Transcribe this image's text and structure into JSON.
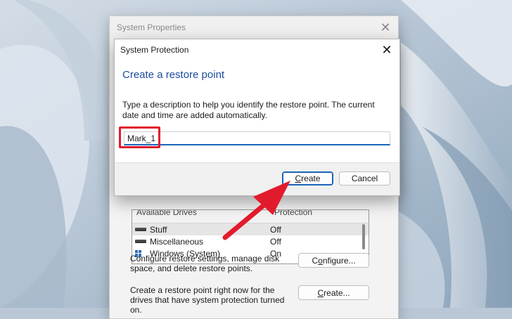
{
  "system_properties": {
    "title": "System Properties",
    "close_glyph": "✕",
    "drives": {
      "header_name": "Available Drives",
      "header_status": "Protection",
      "items": [
        {
          "name": "Stuff",
          "status": "Off",
          "icon": "drive-icon"
        },
        {
          "name": "Miscellaneous",
          "status": "Off",
          "icon": "drive-icon"
        },
        {
          "name": "Windows (System)",
          "status": "On",
          "icon": "windows-drive-icon"
        }
      ]
    },
    "configure_text": "Configure restore settings, manage disk space, and delete restore points.",
    "configure_button": {
      "pre": "C",
      "ul": "o",
      "post": "nfigure..."
    },
    "create_text": "Create a restore point right now for the drives that have system protection turned on.",
    "create_button": {
      "pre": "",
      "ul": "C",
      "post": "reate..."
    }
  },
  "dialog": {
    "title": "System Protection",
    "close_glyph": "✕",
    "heading": "Create a restore point",
    "description": "Type a description to help you identify the restore point. The current date and time are added automatically.",
    "input_value": "Mark_1",
    "create_button": {
      "pre": "",
      "ul": "C",
      "post": "reate"
    },
    "cancel_label": "Cancel"
  },
  "colors": {
    "accent": "#1a64b8",
    "heading": "#1a4b9c",
    "annotation": "#e21b2c"
  }
}
